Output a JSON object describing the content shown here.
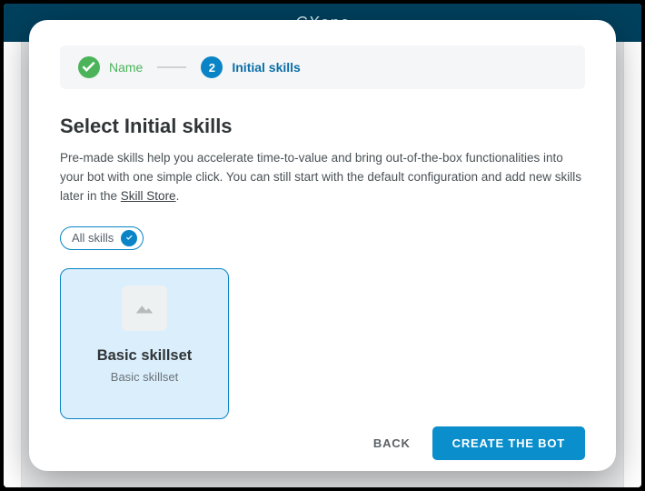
{
  "background": {
    "brand": "CXone"
  },
  "stepper": {
    "step1": {
      "label": "Name"
    },
    "step2": {
      "number": "2",
      "label": "Initial skills"
    }
  },
  "main": {
    "heading": "Select Initial skills",
    "description_pre": "Pre-made skills help you accelerate time-to-value and bring out-of-the-box functionalities into your bot with one simple click. You can still start with the default configuration and add new skills later in the ",
    "description_link": "Skill Store",
    "description_post": "."
  },
  "filters": {
    "all": "All skills"
  },
  "cards": [
    {
      "title": "Basic skillset",
      "subtitle": "Basic skillset"
    }
  ],
  "footer": {
    "back": "BACK",
    "create": "CREATE THE BOT"
  }
}
